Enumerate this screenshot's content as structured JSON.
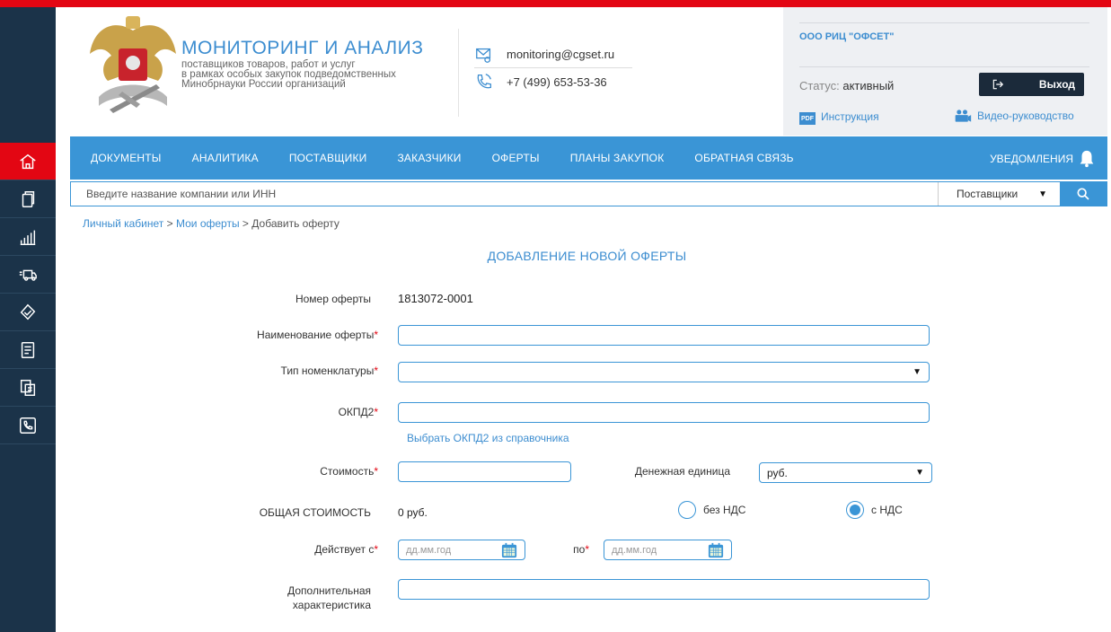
{
  "brand": {
    "title": "МОНИТОРИНГ И АНАЛИЗ",
    "sub1": "поставщиков товаров, работ и услуг",
    "sub2": "в рамках особых закупок подведомственных",
    "sub3": "Минобрнауки России организаций"
  },
  "contact": {
    "email": "monitoring@cgset.ru",
    "phone": "+7 (499) 653-53-36"
  },
  "account": {
    "name": "ООО РИЦ \"ОФСЕТ\"",
    "status_label": "Статус:",
    "status_value": "активный",
    "logout": "Выход",
    "instruction": "Инструкция",
    "pdf": "PDF",
    "video": "Видео-руководство"
  },
  "nav": {
    "items": [
      "ДОКУМЕНТЫ",
      "АНАЛИТИКА",
      "ПОСТАВЩИКИ",
      "ЗАКАЗЧИКИ",
      "ОФЕРТЫ",
      "ПЛАНЫ ЗАКУПОК",
      "ОБРАТНАЯ СВЯЗЬ"
    ],
    "notifications": "УВЕДОМЛЕНИЯ"
  },
  "search": {
    "placeholder": "Введите название компании или ИНН",
    "scope": "Поставщики"
  },
  "breadcrumb": {
    "home": "Личный кабинет",
    "offers": "Мои оферты",
    "current": "Добавить оферту",
    "sep": ">"
  },
  "page_title": "ДОБАВЛЕНИЕ НОВОЙ ОФЕРТЫ",
  "form": {
    "number_label": "Номер оферты",
    "number_value": "1813072-0001",
    "name_label": "Наименование оферты",
    "type_label": "Тип номенклатуры",
    "okpd_label": "ОКПД2",
    "okpd_link": "Выбрать ОКПД2 из справочника",
    "cost_label": "Стоимость",
    "currency_label": "Денежная единица",
    "currency_value": "руб.",
    "total_label": "ОБЩАЯ СТОИМОСТЬ",
    "total_value": "0 руб.",
    "vat_no": "без НДС",
    "vat_yes": "с НДС",
    "valid_from_label": "Действует с",
    "valid_to_label": "по",
    "date_placeholder": "дд.мм.год",
    "extra_label_1": "Дополнительная",
    "extra_label_2": "характеристика",
    "required_mark": "*"
  },
  "colors": {
    "accent": "#3a95d6",
    "top": "#e30613",
    "sidebar": "#1b3349"
  },
  "sidebar_icons": [
    "home-icon",
    "documents-icon",
    "analytics-icon",
    "suppliers-icon",
    "customers-icon",
    "offers-icon",
    "plans-icon",
    "feedback-icon"
  ]
}
